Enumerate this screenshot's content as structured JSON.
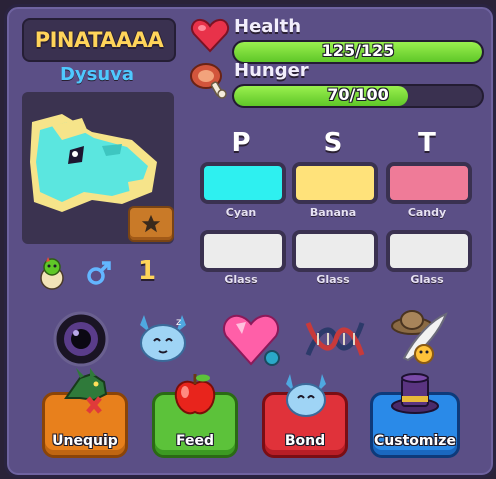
{
  "pet": {
    "name": "PINATAAAA",
    "species": "Dysuva",
    "level": "1"
  },
  "stats": {
    "health": {
      "label": "Health",
      "value": "125/125",
      "fraction": 1.0
    },
    "hunger": {
      "label": "Hunger",
      "value": "70/100",
      "fraction": 0.7
    }
  },
  "colors": {
    "headers": [
      "P",
      "S",
      "T"
    ],
    "slots": [
      {
        "label": "Cyan",
        "hex": "#2ef0f0"
      },
      {
        "label": "Banana",
        "hex": "#ffe27a"
      },
      {
        "label": "Candy",
        "hex": "#ef7b98"
      },
      {
        "label": "Glass",
        "hex": "#ececec"
      },
      {
        "label": "Glass",
        "hex": "#ececec"
      },
      {
        "label": "Glass",
        "hex": "#ececec"
      }
    ]
  },
  "actions": {
    "unequip": "Unequip",
    "feed": "Feed",
    "bond": "Bond",
    "customize": "Customize"
  },
  "icons": [
    "heart-icon",
    "meat-icon",
    "star-icon",
    "egg-icon",
    "male-icon",
    "eye-icon",
    "pet-face-icon",
    "gem-heart-icon",
    "dna-icon",
    "hat-feather-icon",
    "dragon-icon",
    "apple-icon",
    "top-hat-icon"
  ]
}
